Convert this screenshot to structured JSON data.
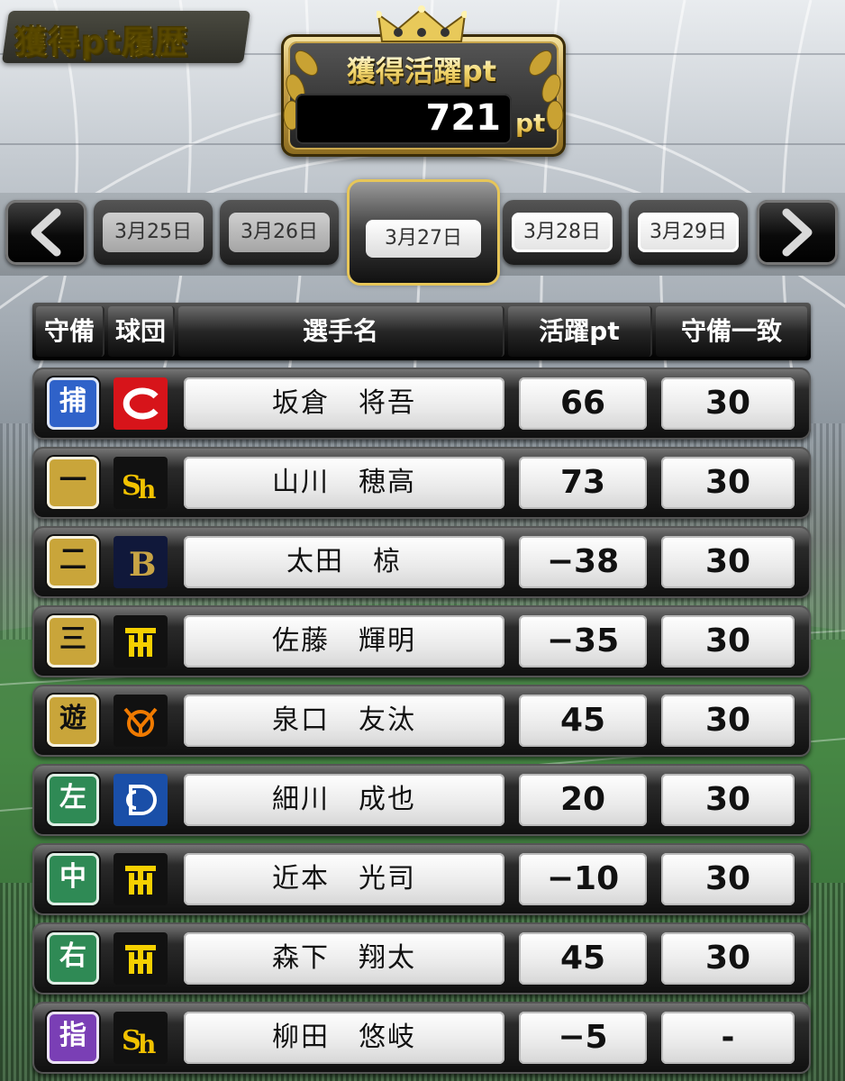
{
  "screen_title": "獲得pt履歴",
  "total": {
    "label": "獲得活躍pt",
    "value": "721",
    "unit": "pt"
  },
  "date_nav": {
    "prev_icon": "chevron-left-icon",
    "next_icon": "chevron-right-icon",
    "dates": [
      "3月25日",
      "3月26日",
      "3月27日",
      "3月28日",
      "3月29日"
    ],
    "selected": "3月27日"
  },
  "table": {
    "headers": {
      "position": "守備",
      "team": "球団",
      "player": "選手名",
      "points": "活躍pt",
      "defense": "守備一致"
    },
    "rows": [
      {
        "position": "捕",
        "pos_color": "#2f62c9",
        "team_icon": "carp-c-logo",
        "player": "坂倉　将吾",
        "points": "66",
        "defense": "30"
      },
      {
        "position": "一",
        "pos_color": "#c9a53a",
        "team_icon": "hawks-sh-logo",
        "player": "山川　穂高",
        "points": "73",
        "defense": "30"
      },
      {
        "position": "二",
        "pos_color": "#c9a53a",
        "team_icon": "buffaloes-b-logo",
        "player": "太田　椋",
        "points": "−38",
        "defense": "30"
      },
      {
        "position": "三",
        "pos_color": "#c9a53a",
        "team_icon": "tigers-ht-logo",
        "player": "佐藤　輝明",
        "points": "−35",
        "defense": "30"
      },
      {
        "position": "遊",
        "pos_color": "#c9a53a",
        "team_icon": "giants-yg-logo",
        "player": "泉口　友汰",
        "points": "45",
        "defense": "30"
      },
      {
        "position": "左",
        "pos_color": "#2f8a55",
        "team_icon": "dragons-d-logo",
        "player": "細川　成也",
        "points": "20",
        "defense": "30"
      },
      {
        "position": "中",
        "pos_color": "#2f8a55",
        "team_icon": "tigers-ht-logo",
        "player": "近本　光司",
        "points": "−10",
        "defense": "30"
      },
      {
        "position": "右",
        "pos_color": "#2f8a55",
        "team_icon": "tigers-ht-logo",
        "player": "森下　翔太",
        "points": "45",
        "defense": "30"
      },
      {
        "position": "指",
        "pos_color": "#7a3fb5",
        "team_icon": "hawks-sh-logo",
        "player": "柳田　悠岐",
        "points": "−5",
        "defense": "-"
      }
    ]
  }
}
